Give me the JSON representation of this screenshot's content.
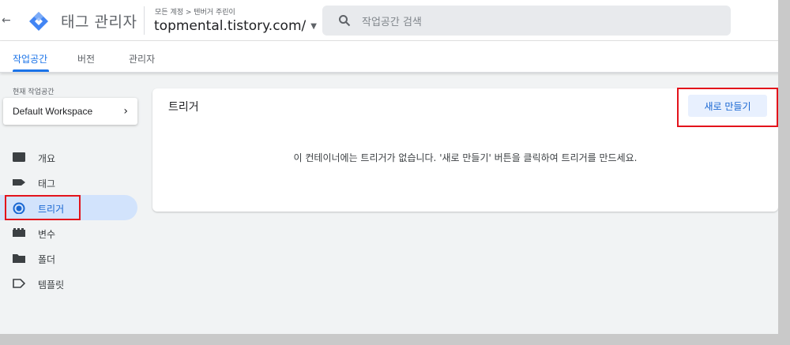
{
  "header": {
    "back_icon": "arrow-left-icon",
    "logo_icon": "gtm-diamond-logo",
    "app_title": "태그 관리자",
    "breadcrumb": "모든 계정 > 텐버거 주린이",
    "container_name": "topmental.tistory.com/",
    "search_placeholder": "작업공간 검색"
  },
  "tabs": [
    {
      "label": "작업공간",
      "active": true
    },
    {
      "label": "버전",
      "active": false
    },
    {
      "label": "관리자",
      "active": false
    }
  ],
  "sidebar": {
    "workspace_label": "현재 작업공간",
    "workspace_name": "Default Workspace",
    "items": [
      {
        "label": "개요",
        "icon": "overview-folder-icon",
        "active": false
      },
      {
        "label": "태그",
        "icon": "tag-icon",
        "active": false
      },
      {
        "label": "트리거",
        "icon": "trigger-icon",
        "active": true
      },
      {
        "label": "변수",
        "icon": "variables-icon",
        "active": false
      },
      {
        "label": "폴더",
        "icon": "folder-icon",
        "active": false
      },
      {
        "label": "템플릿",
        "icon": "template-icon",
        "active": false
      }
    ]
  },
  "main": {
    "title": "트리거",
    "new_button": "새로 만들기",
    "empty_message": "이 컨테이너에는 트리거가 없습니다. '새로 만들기' 버튼을 클릭하여 트리거를 만드세요."
  },
  "colors": {
    "accent": "#1a73e8",
    "highlight": "#e3131b",
    "active_nav_bg": "#d2e3fc"
  }
}
